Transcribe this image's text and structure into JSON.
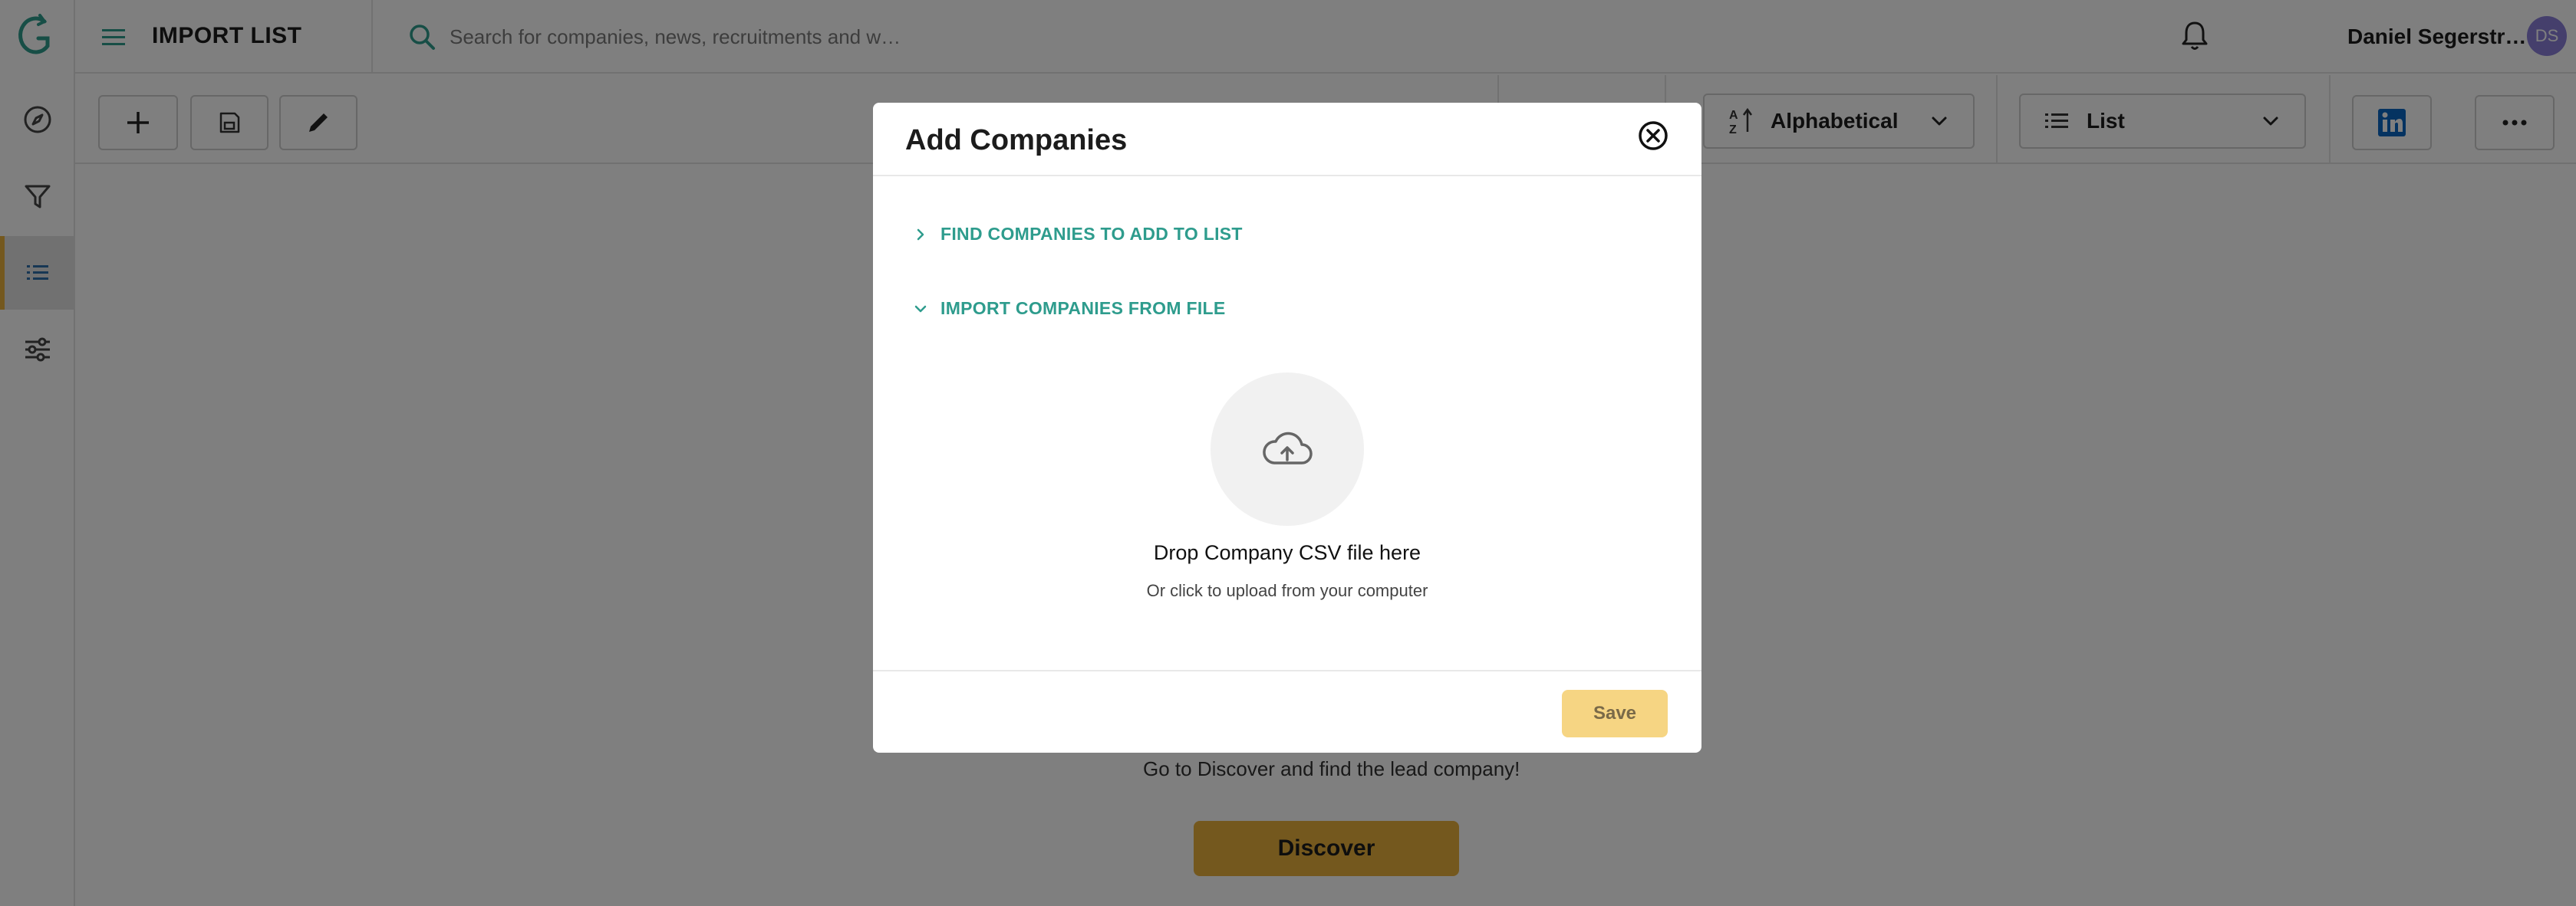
{
  "header": {
    "page_title": "IMPORT LIST",
    "search_placeholder": "Search for companies, news, recruitments and w…",
    "user_name": "Daniel Segerstr…",
    "avatar_initials": "DS"
  },
  "toolbar": {
    "sort_label": "Alphabetical",
    "view_label": "List"
  },
  "main": {
    "empty_message": "Go to Discover and find the lead company!",
    "discover_label": "Discover"
  },
  "modal": {
    "title": "Add Companies",
    "sections": [
      {
        "label": "FIND COMPANIES TO ADD TO LIST",
        "expanded": false
      },
      {
        "label": "IMPORT COMPANIES FROM FILE",
        "expanded": true
      }
    ],
    "dropzone": {
      "title": "Drop Company CSV file here",
      "subtitle": "Or click to upload from your computer"
    },
    "save_label": "Save"
  },
  "colors": {
    "accent_teal": "#2e9c8d",
    "brand_yellow": "#e8b13c",
    "save_disabled": "#f6d583",
    "avatar": "#8a7fd9"
  },
  "icons": [
    "logo-icon",
    "compass-icon",
    "filter-icon",
    "list-icon",
    "sliders-icon",
    "menu-icon",
    "search-icon",
    "bell-icon",
    "chevron-down-icon",
    "plus-icon",
    "save-icon",
    "pencil-icon",
    "sort-az-icon",
    "linkedin-icon",
    "more-icon",
    "close-icon",
    "chevron-right-icon",
    "cloud-upload-icon"
  ]
}
